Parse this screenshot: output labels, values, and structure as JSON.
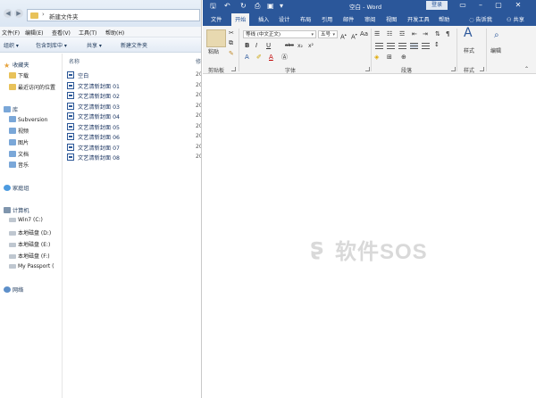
{
  "explorer": {
    "path": "新建文件夹",
    "menu": [
      "文件(F)",
      "编辑(E)",
      "查看(V)",
      "工具(T)",
      "帮助(H)"
    ],
    "commands": [
      "组织 ▾",
      "包含到库中 ▾",
      "共享 ▾",
      "新建文件夹"
    ],
    "nav": {
      "favorites": {
        "label": "收藏夹",
        "items": [
          "下载",
          "最近访问的位置"
        ]
      },
      "libraries": {
        "label": "库",
        "items": [
          "Subversion",
          "视频",
          "图片",
          "文档",
          "音乐"
        ]
      },
      "homegroup": {
        "label": "家庭组"
      },
      "computer": {
        "label": "计算机",
        "items": [
          "Win7 (C:)",
          "本地磁盘 (D:)",
          "本地磁盘 (E:)",
          "本地磁盘 (F:)",
          "My Passport ("
        ]
      },
      "network": {
        "label": "网络"
      }
    },
    "columns": {
      "name": "名称",
      "date": "修"
    },
    "files": [
      {
        "name": "空白",
        "date": "20"
      },
      {
        "name": "文艺清新封面 01",
        "date": "20"
      },
      {
        "name": "文艺清新封面 02",
        "date": "20"
      },
      {
        "name": "文艺清新封面 03",
        "date": "20"
      },
      {
        "name": "文艺清新封面 04",
        "date": "20"
      },
      {
        "name": "文艺清新封面 05",
        "date": "20"
      },
      {
        "name": "文艺清新封面 06",
        "date": "20"
      },
      {
        "name": "文艺清新封面 07",
        "date": "20"
      },
      {
        "name": "文艺清新封面 08",
        "date": "20"
      }
    ]
  },
  "word": {
    "title": "空白 - Word",
    "login": "登录",
    "tabs": [
      "文件",
      "开始",
      "插入",
      "设计",
      "布局",
      "引用",
      "邮件",
      "审阅",
      "视图",
      "开发工具",
      "帮助"
    ],
    "tell_me": "告诉我",
    "share": "共享",
    "ribbon": {
      "clipboard": {
        "label": "剪贴板",
        "paste": "粘贴"
      },
      "font": {
        "label": "字体",
        "font_name": "等线 (中文正文)",
        "font_size": "五号",
        "bold": "B",
        "italic": "I",
        "underline": "U",
        "strike": "abc",
        "sub": "x₂",
        "sup": "x²",
        "font_color": "A"
      },
      "paragraph": {
        "label": "段落"
      },
      "styles": {
        "label": "样式",
        "styles_button": "样式"
      },
      "editing": {
        "button": "编辑"
      }
    },
    "colors": {
      "title_bar": "#2b579a",
      "ribbon_bg": "#f3f3f3"
    }
  },
  "watermark": {
    "text": "软件SOS"
  }
}
